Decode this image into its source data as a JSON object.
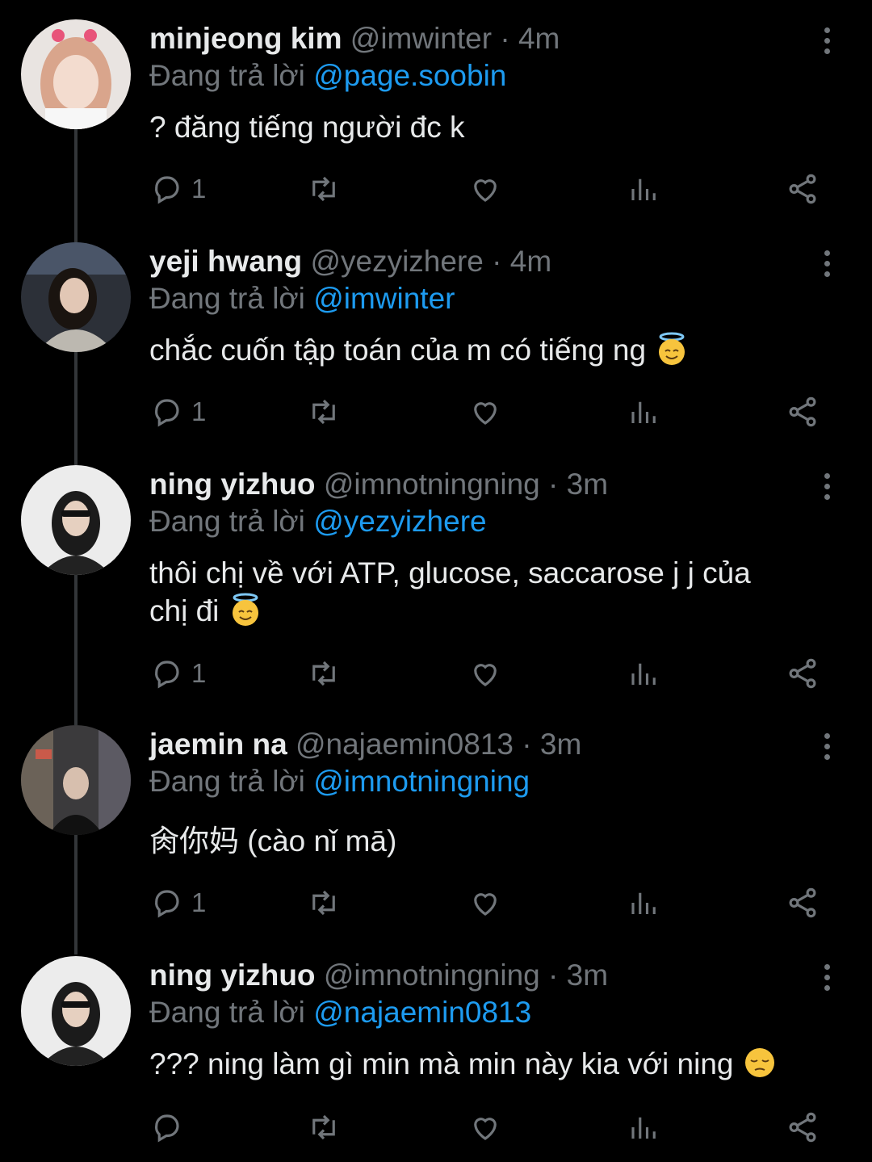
{
  "tweets": [
    {
      "name": "minjeong kim",
      "handle": "@imwinter",
      "time": "· 4m",
      "reply_prefix": "Đang trả lời",
      "reply_to": "@page.soobin",
      "lines": [
        "? đăng tiếng người đc k"
      ],
      "reply_count": "1",
      "emoji": ""
    },
    {
      "name": "yeji hwang",
      "handle": "@yezyizhere",
      "time": "· 4m",
      "reply_prefix": "Đang trả lời",
      "reply_to": "@imwinter",
      "lines": [
        "chắc cuốn tập toán của m có tiếng ng"
      ],
      "reply_count": "1",
      "emoji": "smiling-face-with-halo"
    },
    {
      "name": "ning yizhuo",
      "handle": "@imnotningning",
      "time": "· 3m",
      "reply_prefix": "Đang trả lời",
      "reply_to": "@yezyizhere",
      "lines": [
        "thôi chị về với ATP, glucose, saccarose j j của",
        "chị đi"
      ],
      "reply_count": "1",
      "emoji": "smiling-face-with-halo"
    },
    {
      "name": "jaemin na",
      "handle": "@najaemin0813",
      "time": "· 3m",
      "reply_prefix": "Đang trả lời",
      "reply_to": "@imnotningning",
      "lines": [
        "肏你妈 (cào nǐ mā)"
      ],
      "reply_count": "1",
      "emoji": ""
    },
    {
      "name": "ning yizhuo",
      "handle": "@imnotningning",
      "time": "· 3m",
      "reply_prefix": "Đang trả lời",
      "reply_to": "@najaemin0813",
      "lines": [
        "??? ning làm gì min mà min này kia với ning"
      ],
      "reply_count": "",
      "emoji": "pensive-face"
    }
  ],
  "colors": {
    "background": "#000000",
    "text": "#e7e9ea",
    "muted": "#71767b",
    "mention": "#1d9bf0",
    "thread_line": "#333639"
  },
  "icons": [
    "reply-icon",
    "retweet-icon",
    "like-icon",
    "views-icon",
    "share-icon",
    "more-icon"
  ]
}
